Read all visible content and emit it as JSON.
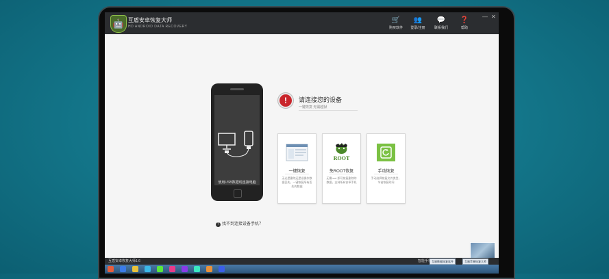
{
  "app": {
    "title": "互盾安卓恢复大师",
    "subtitle": "HD ANDROID DATA RECOVERY",
    "logo_glyph": "🤖"
  },
  "toolbar": {
    "buttons": [
      {
        "label": "购买软件",
        "icon": "cart-icon",
        "glyph": "🛒"
      },
      {
        "label": "登录/注册",
        "icon": "user-icon",
        "glyph": "👥"
      },
      {
        "label": "联系我们",
        "icon": "chat-icon",
        "glyph": "💬"
      },
      {
        "label": "帮助",
        "icon": "help-icon",
        "glyph": "❓"
      }
    ],
    "min_glyph": "—",
    "close_glyph": "✕"
  },
  "phone": {
    "message": "使用USB数据线连接电脑"
  },
  "help_link": "找不到连接设备手机？",
  "connect": {
    "title": "请连接您的设备",
    "subtitle": "一键恢复 无需越狱"
  },
  "cards": [
    {
      "name": "一键恢复",
      "thumb": "software-screenshot-icon",
      "desc": "无论是删除还是误操作数据丢失，一键恢复所有丢失的数据"
    },
    {
      "name": "免ROOT恢复",
      "thumb": "root-android-icon",
      "desc": "无需root 即可恢复删除的数据，支持所有安卓手机"
    },
    {
      "name": "手动恢复",
      "thumb": "manual-recover-icon",
      "desc": "手动选择恢复文件类型，节省恢复时间"
    }
  ],
  "statusbar": {
    "left": "互盾安卓恢复大师1.6",
    "right": "智能手机",
    "task1": "互盾数据恢复软件",
    "task2": "互盾苹果恢复大师"
  },
  "colors": {
    "titlebar": "#2b2d30",
    "warning": "#c9252b",
    "root_green": "#4c8a2a",
    "manual_green": "#7bc143"
  }
}
